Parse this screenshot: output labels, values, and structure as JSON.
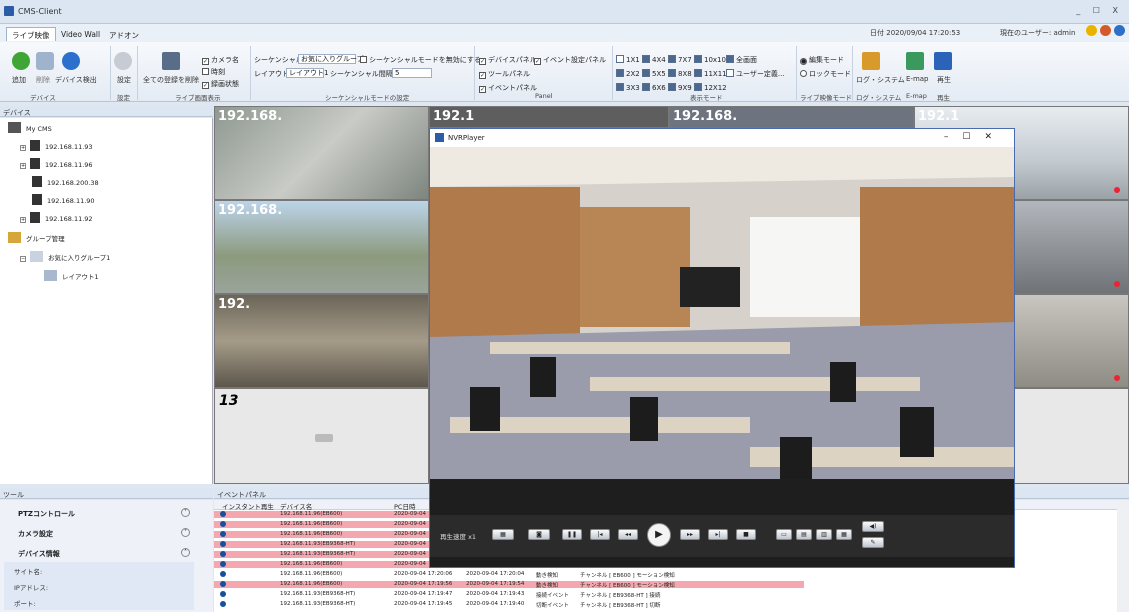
{
  "window": {
    "title": "CMS-Client",
    "controls": "_ ☐ X"
  },
  "tabs": [
    {
      "label": "ライブ映像",
      "active": true
    },
    {
      "label": "Video Wall",
      "active": false
    },
    {
      "label": "アドオン",
      "active": false
    }
  ],
  "status": {
    "date_label": "日付",
    "date_value": "2020/09/04 17:20:53",
    "user_label": "現在のユーザー: admin"
  },
  "ribbon": {
    "device": {
      "add": "追加",
      "delete": "削除",
      "detect": "デバイス検出",
      "group": "デバイス"
    },
    "settings": {
      "label": "設定",
      "group": "設定"
    },
    "live": {
      "delete_all": "全ての登録を削除",
      "camera_name": "カメラ名",
      "time": "時刻",
      "rec_status": "録画状態",
      "group": "ライブ画面表示"
    },
    "sequence": {
      "label": "シーケンシャル",
      "favorite": "お気に入りグループ",
      "disable": "シーケンシャルモードを無効にする",
      "layout_label": "レイアウト",
      "layout_value": "レイアウト1",
      "interval_label": "シーケンシャル間隔",
      "interval_value": "5",
      "group": "シーケンシャルモードの設定"
    },
    "panel": {
      "device_panel": "デバイスパネル",
      "event_setting_panel": "イベント設定パネル",
      "tool_panel": "ツールパネル",
      "event_panel": "イベントパネル",
      "group": "Panel"
    },
    "display": {
      "layouts": [
        "1X1",
        "4X4",
        "7X7",
        "10x10",
        "全画面",
        "2X2",
        "5X5",
        "8X8",
        "11X11",
        "ユーザー定義...",
        "3X3",
        "6X6",
        "9X9",
        "12X12"
      ],
      "group": "表示モード"
    },
    "mode": {
      "edit": "編集モード",
      "lock": "ロックモード",
      "group": "ライブ映像モード"
    },
    "log": {
      "label": "ログ・システム",
      "group": "ログ・システム"
    },
    "emap": {
      "label": "E-map",
      "group": "E-map"
    },
    "playback": {
      "label": "再生",
      "group": "再生"
    }
  },
  "device_panel": {
    "header": "デバイス",
    "root": "My CMS",
    "devices": [
      "192.168.11.93",
      "192.168.11.96",
      "192.168.200.38",
      "192.168.11.90",
      "192.168.11.92"
    ],
    "group_mgmt": "グループ管理",
    "favorite_group": "お気に入りグループ1",
    "layout": "レイアウト1"
  },
  "grid": {
    "cells": [
      {
        "label": "192.168."
      },
      {
        "label": "192.168."
      },
      {
        "label": "192."
      },
      {
        "label": "13"
      },
      {
        "label": "192.1"
      },
      {
        "label": "192.168."
      },
      {
        "label": "192.1"
      }
    ]
  },
  "nvr": {
    "title": "NVRPlayer",
    "speed_label": "再生速度 x1"
  },
  "tool_panel": {
    "header": "ツール",
    "ptz": "PTZコントロール",
    "camera": "カメラ設定",
    "device_info": "デバイス情報",
    "site": "サイト名:",
    "ip": "IPアドレス:",
    "port": "ポート:"
  },
  "event_panel": {
    "header": "イベントパネル",
    "columns": [
      "インスタント再生",
      "デバイス名",
      "PC日時"
    ],
    "rows": [
      {
        "device": "192.168.11.96(EB600)",
        "pc": "2020-09-04",
        "dev_time": "",
        "type": "",
        "detail": "",
        "hl": true
      },
      {
        "device": "192.168.11.96(EB600)",
        "pc": "2020-09-04",
        "dev_time": "",
        "type": "",
        "detail": "",
        "hl": true
      },
      {
        "device": "192.168.11.96(EB600)",
        "pc": "2020-09-04",
        "dev_time": "",
        "type": "",
        "detail": "",
        "hl": true
      },
      {
        "device": "192.168.11.93(EB9368-HT)",
        "pc": "2020-09-04",
        "dev_time": "",
        "type": "",
        "detail": "",
        "hl": true
      },
      {
        "device": "192.168.11.93(EB9368-HT)",
        "pc": "2020-09-04",
        "dev_time": "",
        "type": "",
        "detail": "",
        "hl": true
      },
      {
        "device": "192.168.11.96(EB600)",
        "pc": "2020-09-04",
        "dev_time": "",
        "type": "",
        "detail": "",
        "hl": true
      },
      {
        "device": "192.168.11.96(EB600)",
        "pc": "2020-09-04 17:20:06",
        "dev_time": "2020-09-04 17:20:04",
        "type": "動き検知",
        "detail": "チャンネル [ EB600 ] モーション検知",
        "hl": false
      },
      {
        "device": "192.168.11.96(EB600)",
        "pc": "2020-09-04 17:19:56",
        "dev_time": "2020-09-04 17:19:54",
        "type": "動き検知",
        "detail": "チャンネル [ EB600 ] モーション検知",
        "hl": true
      },
      {
        "device": "192.168.11.93(EB9368-HT)",
        "pc": "2020-09-04 17:19:47",
        "dev_time": "2020-09-04 17:19:43",
        "type": "接続イベント",
        "detail": "チャンネル [ EB9368-HT ] 接続",
        "hl": false
      },
      {
        "device": "192.168.11.93(EB9368-HT)",
        "pc": "2020-09-04 17:19:45",
        "dev_time": "2020-09-04 17:19:40",
        "type": "切断イベント",
        "detail": "チャンネル [ EB9368-HT ] 切断",
        "hl": false
      }
    ]
  }
}
